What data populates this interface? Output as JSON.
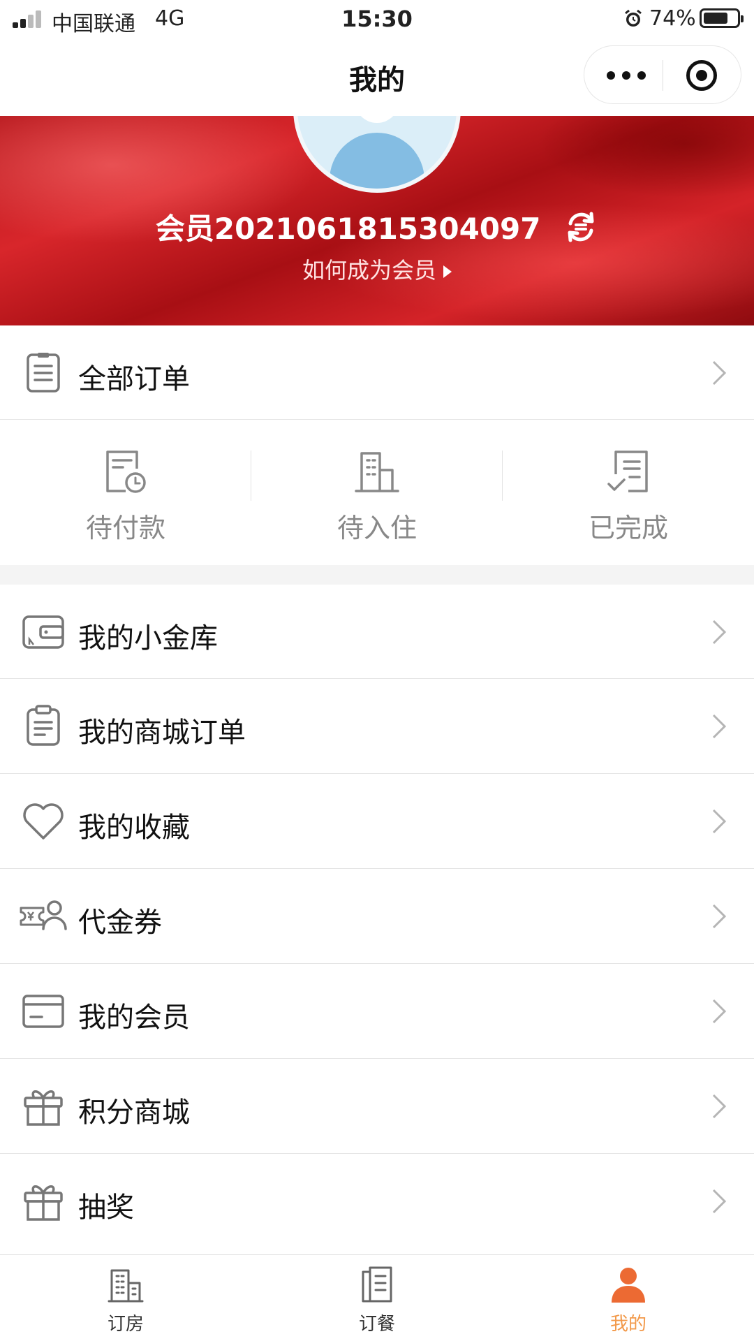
{
  "status_bar": {
    "carrier": "中国联通",
    "network": "4G",
    "time": "15:30",
    "battery_percent": "74%",
    "battery_level": 0.74
  },
  "nav": {
    "title": "我的"
  },
  "profile": {
    "member_id": "会员2021061815304097",
    "become_member_link": "如何成为会员"
  },
  "orders": {
    "all_orders_label": "全部订单",
    "statuses": [
      {
        "label": "待付款",
        "icon": "pending-payment-icon"
      },
      {
        "label": "待入住",
        "icon": "building-icon"
      },
      {
        "label": "已完成",
        "icon": "completed-list-icon"
      }
    ]
  },
  "menu": [
    {
      "label": "我的小金库",
      "icon": "wallet-icon"
    },
    {
      "label": "我的商城订单",
      "icon": "clipboard-icon"
    },
    {
      "label": "我的收藏",
      "icon": "heart-icon"
    },
    {
      "label": "代金券",
      "icon": "voucher-icon"
    },
    {
      "label": "我的会员",
      "icon": "card-icon"
    },
    {
      "label": "积分商城",
      "icon": "gift-icon"
    },
    {
      "label": "抽奖",
      "icon": "gift-icon"
    }
  ],
  "tab_bar": {
    "items": [
      {
        "label": "订房",
        "icon": "hotel-icon",
        "active": false
      },
      {
        "label": "订餐",
        "icon": "menu-doc-icon",
        "active": false
      },
      {
        "label": "我的",
        "icon": "person-icon",
        "active": true
      }
    ]
  },
  "colors": {
    "banner_red": "#c81d22",
    "active_tab": "#f2994a",
    "icon_gray": "#777777"
  }
}
